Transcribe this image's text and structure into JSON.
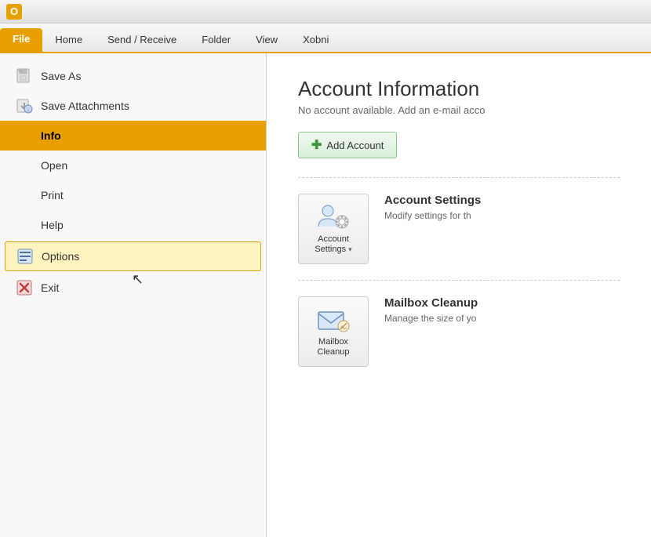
{
  "titlebar": {
    "icon_label": "O"
  },
  "ribbon": {
    "tabs": [
      {
        "label": "File",
        "active": true
      },
      {
        "label": "Home",
        "active": false
      },
      {
        "label": "Send / Receive",
        "active": false
      },
      {
        "label": "Folder",
        "active": false
      },
      {
        "label": "View",
        "active": false
      },
      {
        "label": "Xobni",
        "active": false
      }
    ]
  },
  "sidebar": {
    "items": [
      {
        "id": "save-as",
        "label": "Save As",
        "icon": "saveas",
        "active": false,
        "highlighted": false
      },
      {
        "id": "save-attachments",
        "label": "Save Attachments",
        "icon": "saveattach",
        "active": false,
        "highlighted": false
      },
      {
        "id": "info",
        "label": "Info",
        "icon": "",
        "active": true,
        "highlighted": false
      },
      {
        "id": "open",
        "label": "Open",
        "icon": "",
        "active": false,
        "highlighted": false
      },
      {
        "id": "print",
        "label": "Print",
        "icon": "",
        "active": false,
        "highlighted": false
      },
      {
        "id": "help",
        "label": "Help",
        "icon": "",
        "active": false,
        "highlighted": false
      },
      {
        "id": "options",
        "label": "Options",
        "icon": "options",
        "active": false,
        "highlighted": true
      },
      {
        "id": "exit",
        "label": "Exit",
        "icon": "exit",
        "active": false,
        "highlighted": false
      }
    ]
  },
  "content": {
    "title": "Account Information",
    "subtitle": "No account available. Add an e-mail acco",
    "add_account_label": "Add Account",
    "sections": [
      {
        "id": "account-settings",
        "button_label": "Account\nSettings",
        "button_dropdown": "▾",
        "heading": "Account Settings",
        "description": "Modify settings for th"
      },
      {
        "id": "mailbox-cleanup",
        "button_label": "Mailbox\nCleanup",
        "heading": "Mailbox Cleanup",
        "description": "Manage the size of yo"
      }
    ]
  }
}
